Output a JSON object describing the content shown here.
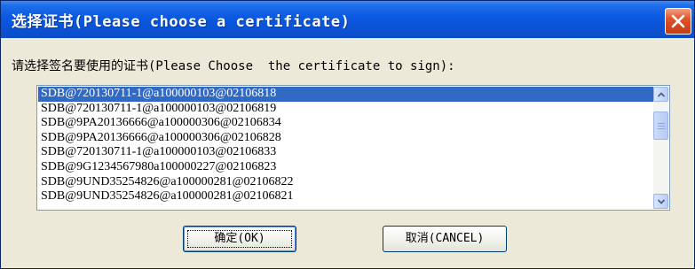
{
  "window": {
    "title": "选择证书(Please choose a certificate)"
  },
  "prompt": {
    "text": "请选择签名要使用的证书(Please Choose  the certificate to sign):"
  },
  "certificates": {
    "items": [
      "SDB@720130711-1@a100000103@02106818",
      "SDB@720130711-1@a100000103@02106819",
      "SDB@9PA20136666@a100000306@02106834",
      "SDB@9PA20136666@a100000306@02106828",
      "SDB@720130711-1@a100000103@02106833",
      "SDB@9G1234567980a100000227@02106823",
      "SDB@9UND35254826@a100000281@02106822",
      "SDB@9UND35254826@a100000281@02106821"
    ],
    "selected_index": 0
  },
  "buttons": {
    "ok_label": "确定(OK)",
    "cancel_label": "取消(CANCEL)"
  },
  "colors": {
    "titlebar": "#0a52d6",
    "selection": "#316ac5",
    "close": "#e0542a",
    "dialog_bg": "#ece9d8"
  },
  "icons": {
    "close": "close-icon",
    "scroll_up": "chevron-up-icon",
    "scroll_down": "chevron-down-icon"
  }
}
